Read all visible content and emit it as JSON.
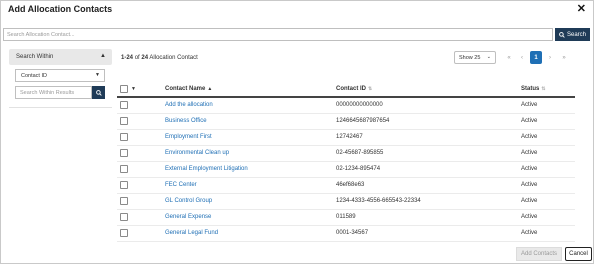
{
  "dialog": {
    "title": "Add Allocation Contacts"
  },
  "search": {
    "placeholder": "Search Allocation Contact...",
    "button_label": "Search"
  },
  "filter": {
    "header_label": "Search Within",
    "field_value": "Contact ID",
    "within_placeholder": "Search Within Results"
  },
  "results": {
    "range": "1-24",
    "of_label": "of",
    "total": "24",
    "entity_label": "Allocation Contact"
  },
  "pager": {
    "page_size_label": "Show 25",
    "current_page": "1",
    "first_symbol": "«",
    "prev_symbol": "‹",
    "next_symbol": "›",
    "last_symbol": "»"
  },
  "table": {
    "columns": {
      "name": "Contact Name",
      "id": "Contact ID",
      "status": "Status"
    },
    "rows": [
      {
        "name": "Add the allocation",
        "id": "00000000000000",
        "status": "Active"
      },
      {
        "name": "Business Office",
        "id": "1246645687987654",
        "status": "Active"
      },
      {
        "name": "Employment First",
        "id": "12742467",
        "status": "Active"
      },
      {
        "name": "Environmental Clean up",
        "id": "02-45687-895855",
        "status": "Active"
      },
      {
        "name": "External Employment Litigation",
        "id": "02-1234-895474",
        "status": "Active"
      },
      {
        "name": "FEC Center",
        "id": "46ef68e63",
        "status": "Active"
      },
      {
        "name": "GL Control Group",
        "id": "1234-4333-4556-665543-22334",
        "status": "Active"
      },
      {
        "name": "General Expense",
        "id": "011589",
        "status": "Active"
      },
      {
        "name": "General Legal Fund",
        "id": "0001-34567",
        "status": "Active"
      }
    ]
  },
  "footer": {
    "add_label": "Add Contacts",
    "cancel_label": "Cancel"
  },
  "icons": {
    "close": "close-icon",
    "search": "search-icon",
    "chevron_up": "chevron-up-icon",
    "caret_down": "caret-down-icon",
    "sort_asc": "sort-ascending-icon",
    "sort": "sort-icon"
  },
  "colors": {
    "primary": "#1f3b57",
    "link": "#1f6fb5",
    "page_active": "#1f6fb5"
  }
}
